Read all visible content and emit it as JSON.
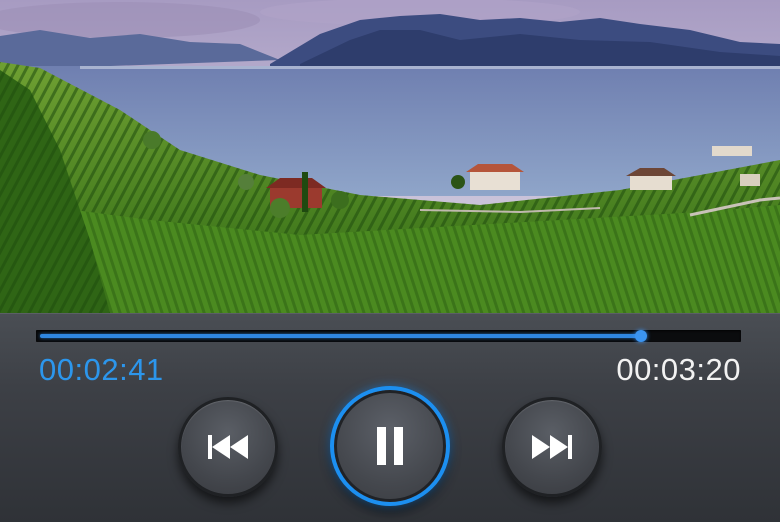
{
  "player": {
    "elapsed": "00:02:41",
    "duration": "00:03:20",
    "progress_fraction": 0.862
  },
  "controls": {
    "previous_icon": "skip-previous-icon",
    "pause_icon": "pause-icon",
    "next_icon": "skip-next-icon"
  },
  "colors": {
    "accent": "#2c96ec",
    "panel": "#3d4046",
    "time_total": "#f2f2f2"
  },
  "artwork": {
    "description_icon": "landscape-image"
  }
}
